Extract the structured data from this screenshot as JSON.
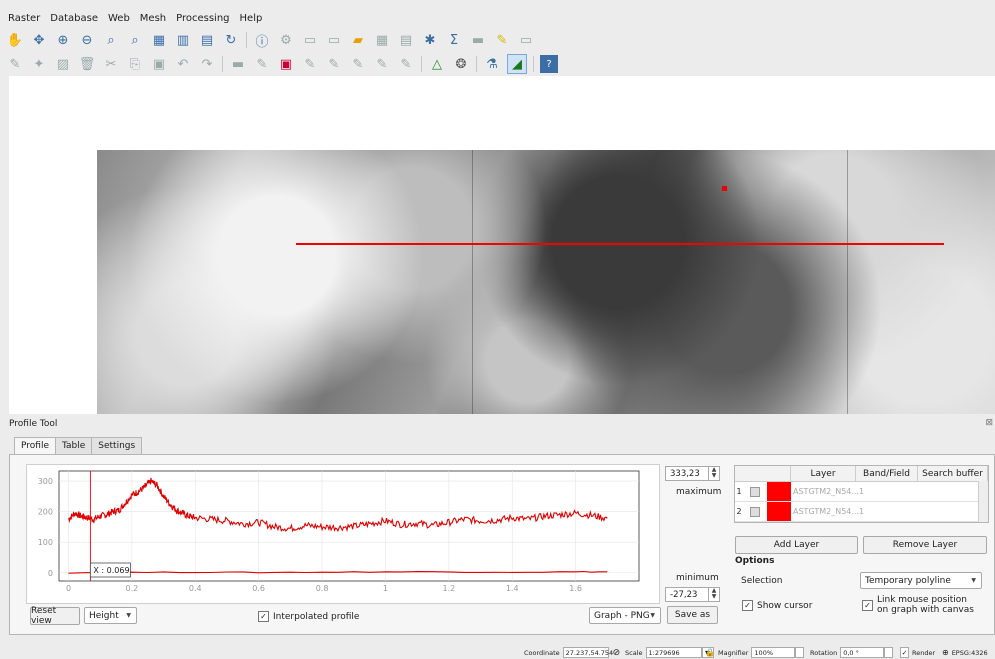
{
  "menu": [
    "Raster",
    "Database",
    "Web",
    "Mesh",
    "Processing",
    "Help"
  ],
  "profile_tool": {
    "title": "Profile Tool",
    "tabs": [
      "Profile",
      "Table",
      "Settings"
    ],
    "active_tab": "Profile",
    "max_value": "333,23",
    "max_label": "maximum",
    "min_value": "-27,23",
    "min_label": "minimum",
    "reset_view": "Reset view",
    "mode_select": "Height",
    "interpolated_profile": "Interpolated profile",
    "interpolated_checked": true,
    "export_format": "Graph - PNG",
    "save_as": "Save as",
    "cursor_readout": "X : 0.069"
  },
  "layers": {
    "headers": [
      "Layer",
      "Band/Field",
      "Search buffer"
    ],
    "rows": [
      {
        "index": "1",
        "color": "#ff0000",
        "layer": "ASTGTM2_N54...",
        "band": "1"
      },
      {
        "index": "2",
        "color": "#ff0000",
        "layer": "ASTGTM2_N54...",
        "band": "1"
      }
    ],
    "add_layer": "Add Layer",
    "remove_layer": "Remove Layer"
  },
  "options": {
    "title": "Options",
    "selection_label": "Selection",
    "selection_value": "Temporary polyline",
    "show_cursor": "Show cursor",
    "show_cursor_checked": true,
    "link_mouse_line1": "Link mouse position",
    "link_mouse_line2": "on graph with canvas",
    "link_mouse_checked": true
  },
  "status": {
    "coordinate_label": "Coordinate",
    "coordinate_value": "27.237,54.754",
    "scale_label": "Scale",
    "scale_value": "1:279696",
    "magnifier_label": "Magnifier",
    "magnifier_value": "100%",
    "rotation_label": "Rotation",
    "rotation_value": "0,0 °",
    "render_label": "Render",
    "render_checked": true,
    "crs": "EPSG:4326"
  },
  "chart_data": {
    "type": "line",
    "x_ticks": [
      "0",
      "0.2",
      "0.4",
      "0.6",
      "0.8",
      "1",
      "1.2",
      "1.4",
      "1.6"
    ],
    "y_ticks": [
      "0",
      "100",
      "200",
      "300"
    ],
    "xlim": [
      -0.03,
      1.8
    ],
    "ylim": [
      -27,
      333
    ],
    "grid": true,
    "cursor_x": 0.069,
    "series": [
      {
        "color": "#e00000",
        "x": [
          0,
          0.02,
          0.04,
          0.06,
          0.08,
          0.1,
          0.12,
          0.14,
          0.16,
          0.18,
          0.2,
          0.22,
          0.24,
          0.26,
          0.28,
          0.3,
          0.32,
          0.34,
          0.36,
          0.38,
          0.4,
          0.45,
          0.5,
          0.55,
          0.6,
          0.65,
          0.7,
          0.75,
          0.8,
          0.85,
          0.9,
          0.95,
          1.0,
          1.05,
          1.1,
          1.15,
          1.2,
          1.25,
          1.3,
          1.35,
          1.4,
          1.45,
          1.5,
          1.55,
          1.6,
          1.65,
          1.7
        ],
        "y": [
          175,
          195,
          185,
          180,
          175,
          185,
          190,
          200,
          205,
          230,
          255,
          265,
          280,
          300,
          285,
          250,
          225,
          205,
          195,
          185,
          180,
          175,
          170,
          160,
          165,
          150,
          145,
          155,
          150,
          148,
          152,
          160,
          170,
          158,
          162,
          155,
          165,
          175,
          170,
          172,
          180,
          175,
          185,
          190,
          195,
          188,
          178
        ]
      },
      {
        "color": "#e00000",
        "x": [
          0,
          0.2,
          0.4,
          0.6,
          0.8,
          1.0,
          1.2,
          1.4,
          1.6,
          1.7
        ],
        "y": [
          0,
          1,
          2,
          1,
          2,
          3,
          3,
          2,
          3,
          3
        ]
      }
    ]
  }
}
